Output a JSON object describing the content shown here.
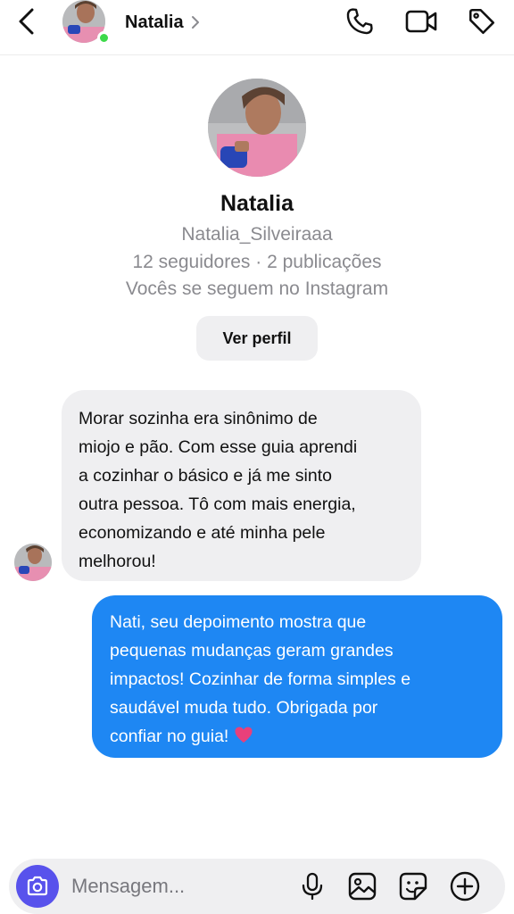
{
  "header": {
    "contact_name": "Natalia",
    "online": true,
    "icons": [
      "back-arrow-icon",
      "chevron-right-icon",
      "phone-icon",
      "video-camera-icon",
      "tag-icon"
    ]
  },
  "profile": {
    "name": "Natalia",
    "username": "Natalia_Silveiraaa",
    "stats": "12 seguidores · 2 publicações",
    "mutual": "Vocês se seguem no Instagram",
    "view_profile_label": "Ver perfil"
  },
  "messages": [
    {
      "direction": "incoming",
      "lines": [
        "Morar sozinha era sinônimo de",
        "miojo e pão. Com esse guia aprendi",
        "a cozinhar o básico e já me sinto",
        "outra pessoa. Tô com mais energia,",
        "economizando e até minha pele",
        "melhorou!"
      ]
    },
    {
      "direction": "outgoing",
      "lines": [
        "Nati, seu depoimento mostra que",
        "pequenas mudanças geram grandes",
        "impactos! Cozinhar de forma simples e",
        "saudável muda tudo. Obrigada por",
        "confiar no guia!"
      ],
      "emoji": "heart-icon"
    }
  ],
  "composer": {
    "placeholder": "Mensagem...",
    "value": "",
    "icons": [
      "camera-icon",
      "microphone-icon",
      "gallery-icon",
      "sticker-icon",
      "plus-icon"
    ]
  },
  "colors": {
    "outgoing_bubble": "#1e87f3",
    "incoming_bubble": "#efeff1",
    "camera_button": "#5852ec",
    "online_dot": "#3dd94a",
    "heart": "#e8407a"
  }
}
